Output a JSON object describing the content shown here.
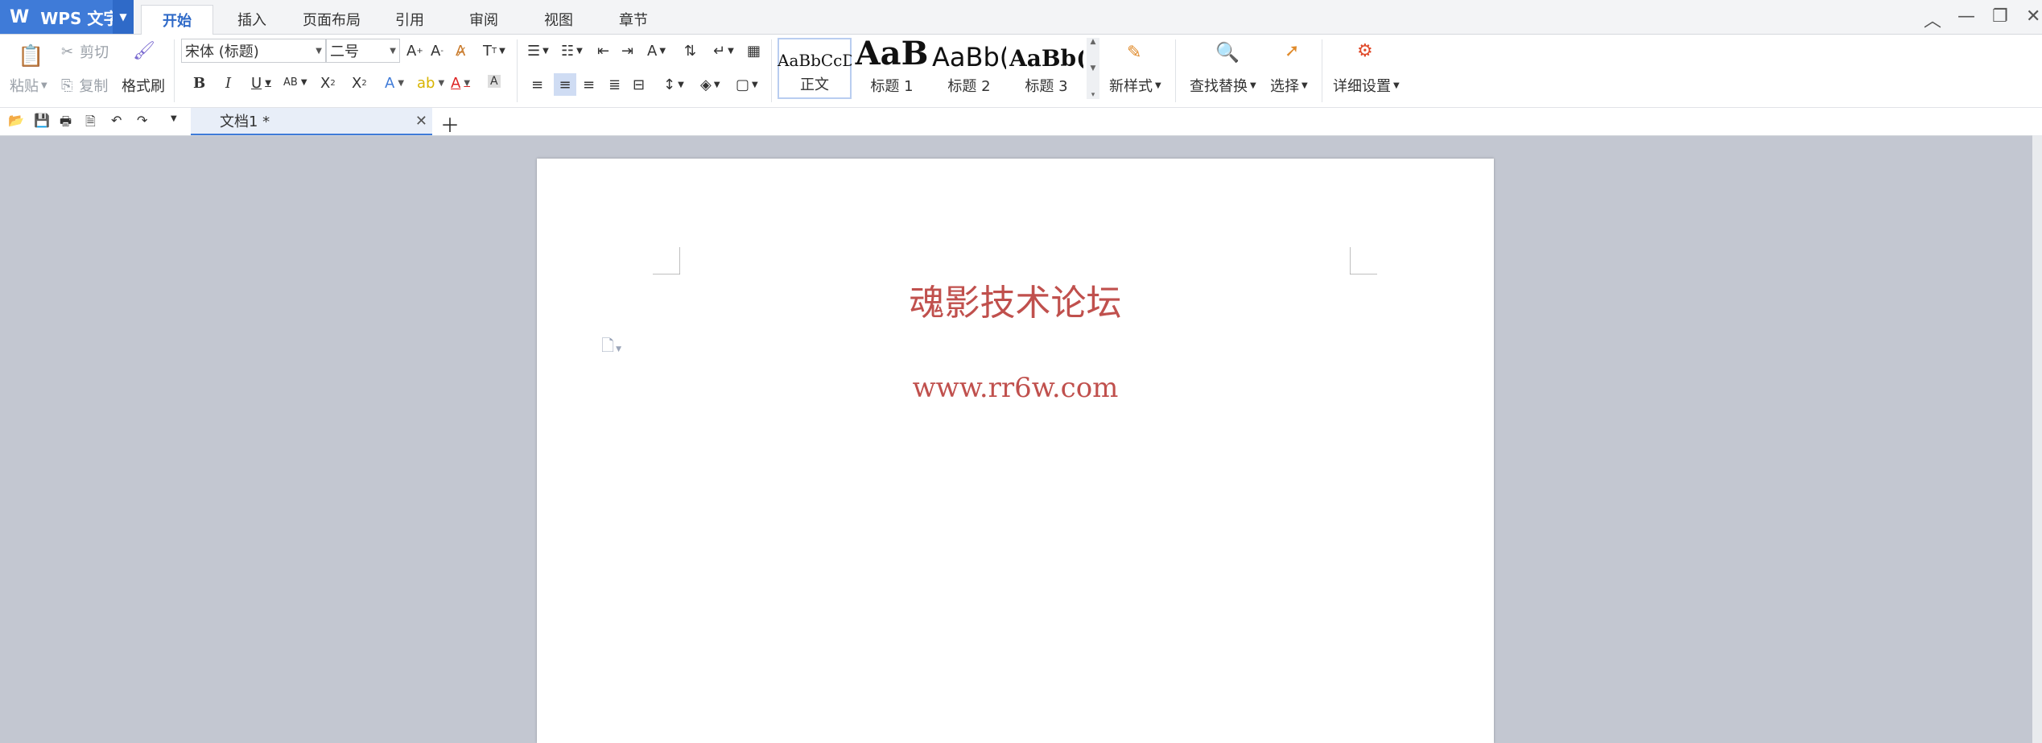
{
  "app": {
    "name": "WPS 文字"
  },
  "menu_tabs": [
    "开始",
    "插入",
    "页面布局",
    "引用",
    "审阅",
    "视图",
    "章节"
  ],
  "clipboard": {
    "paste": "粘贴",
    "cut": "剪切",
    "copy": "复制",
    "format_painter": "格式刷"
  },
  "font": {
    "family": "宋体 (标题)",
    "size": "二号"
  },
  "styles": [
    {
      "sample": "AaBbCcD",
      "label": "正文"
    },
    {
      "sample": "AaB",
      "label": "标题 1"
    },
    {
      "sample": "AaBb(",
      "label": "标题 2"
    },
    {
      "sample": "AaBb(",
      "label": "标题 3"
    }
  ],
  "actions": {
    "new_style": "新样式",
    "find_replace": "查找替换",
    "select": "选择",
    "detail_settings": "详细设置"
  },
  "document_tab": {
    "title": "文档1 *"
  },
  "document": {
    "line1": "魂影技术论坛",
    "line2": "www.rr6w.com",
    "text_color": "#c0504d"
  },
  "colors": {
    "accent": "#3f7bd8",
    "workspace": "#c3c7d1"
  }
}
